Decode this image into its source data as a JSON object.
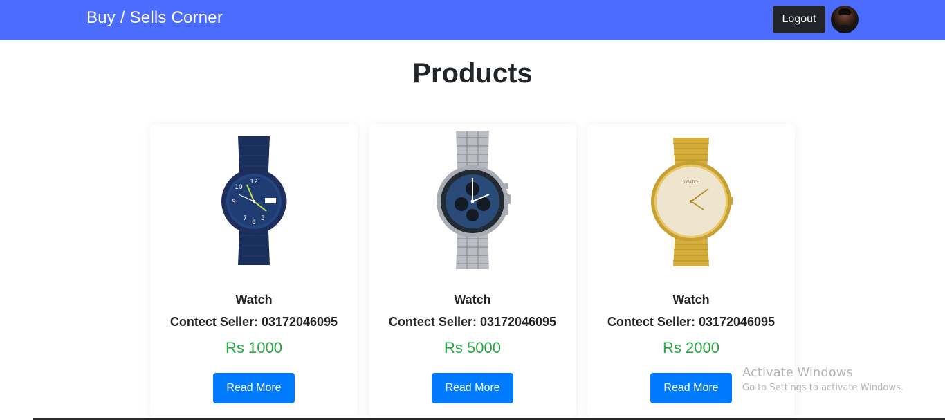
{
  "navbar": {
    "brand": "Buy / Sells Corner",
    "logout_label": "Logout",
    "nav_color": "#4c6bff"
  },
  "page": {
    "title": "Products"
  },
  "products": [
    {
      "name": "Watch",
      "seller": "Contect Seller: 03172046095",
      "price": "Rs 1000",
      "button": "Read More",
      "image_icon": "watch-navy-strap-icon"
    },
    {
      "name": "Watch",
      "seller": "Contect Seller: 03172046095",
      "price": "Rs 5000",
      "button": "Read More",
      "image_icon": "watch-steel-chronograph-icon"
    },
    {
      "name": "Watch",
      "seller": "Contect Seller: 03172046095",
      "price": "Rs 2000",
      "button": "Read More",
      "image_icon": "watch-gold-icon"
    }
  ],
  "watermark": {
    "title": "Activate Windows",
    "subtitle": "Go to Settings to activate Windows."
  },
  "colors": {
    "price": "#28a745",
    "button": "#007bff"
  }
}
